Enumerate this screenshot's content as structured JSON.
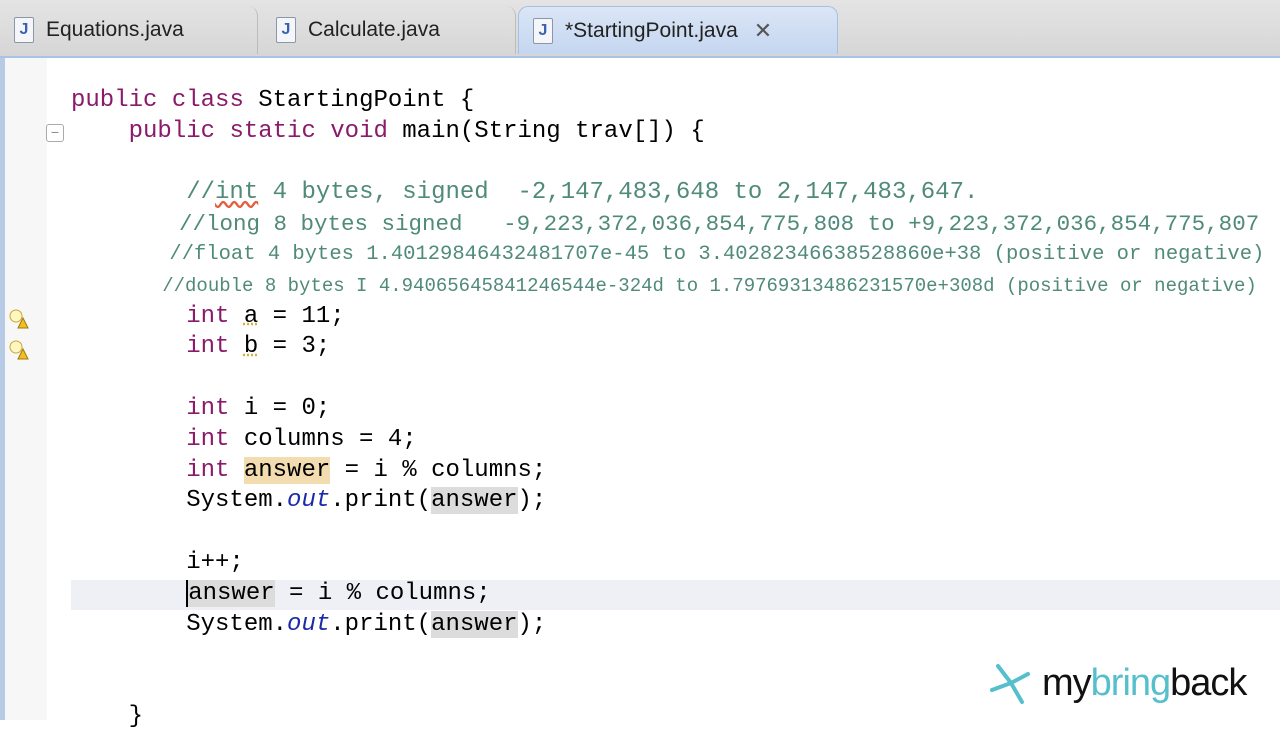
{
  "tabs": [
    {
      "label": "Equations.java",
      "icon": "java-file-icon",
      "active": false
    },
    {
      "label": "Calculate.java",
      "icon": "java-file-icon",
      "active": false
    },
    {
      "label": "*StartingPoint.java",
      "icon": "java-file-warning-icon",
      "active": true,
      "close": "✕"
    }
  ],
  "editor": {
    "lines": [
      [
        {
          "t": "public",
          "c": "kw"
        },
        {
          "t": " "
        },
        {
          "t": "class",
          "c": "kw"
        },
        {
          "t": " StartingPoint {"
        }
      ],
      [
        {
          "t": "    "
        },
        {
          "t": "public",
          "c": "kw"
        },
        {
          "t": " "
        },
        {
          "t": "static",
          "c": "kw"
        },
        {
          "t": " "
        },
        {
          "t": "void",
          "c": "kw"
        },
        {
          "t": " main(String trav[]) {"
        }
      ],
      [],
      [
        {
          "t": "        //",
          "c": "cm"
        },
        {
          "t": "int",
          "c": "cm sq"
        },
        {
          "t": " 4 bytes, signed  -2,147,483,648 to 2,147,483,647.",
          "c": "cm"
        }
      ],
      [
        {
          "t": "        //long 8 bytes signed   -9,223,372,036,854,775,808 to +9,223,372,036,854,775,807",
          "c": "cm"
        }
      ],
      [
        {
          "t": "        //float 4 bytes 1.40129846432481707e-45 to 3.40282346638528860e+38 (positive or negative)",
          "c": "cm"
        }
      ],
      [
        {
          "t": "        //double 8 bytes I 4.94065645841246544e-324d to 1.79769313486231570e+308d (positive or negative)",
          "c": "cm"
        }
      ],
      [
        {
          "t": "        "
        },
        {
          "t": "int",
          "c": "kw"
        },
        {
          "t": " "
        },
        {
          "t": "a",
          "c": "sqy"
        },
        {
          "t": " = 11;"
        }
      ],
      [
        {
          "t": "        "
        },
        {
          "t": "int",
          "c": "kw"
        },
        {
          "t": " "
        },
        {
          "t": "b",
          "c": "sqy"
        },
        {
          "t": " = 3;"
        }
      ],
      [],
      [
        {
          "t": "        "
        },
        {
          "t": "int",
          "c": "kw"
        },
        {
          "t": " i = 0;"
        }
      ],
      [
        {
          "t": "        "
        },
        {
          "t": "int",
          "c": "kw"
        },
        {
          "t": " columns = 4;"
        }
      ],
      [
        {
          "t": "        "
        },
        {
          "t": "int",
          "c": "kw"
        },
        {
          "t": " "
        },
        {
          "t": "answer",
          "c": "hl1"
        },
        {
          "t": " = i % columns;"
        }
      ],
      [
        {
          "t": "        System."
        },
        {
          "t": "out",
          "c": "fld"
        },
        {
          "t": ".print("
        },
        {
          "t": "answer",
          "c": "hl2"
        },
        {
          "t": ");"
        }
      ],
      [],
      [
        {
          "t": "        i++;"
        }
      ],
      [
        {
          "t": "        "
        },
        {
          "t": "answer",
          "c": "hl2 caret"
        },
        {
          "t": " = i % columns;"
        }
      ],
      [
        {
          "t": "        System."
        },
        {
          "t": "out",
          "c": "fld"
        },
        {
          "t": ".print("
        },
        {
          "t": "answer",
          "c": "hl2"
        },
        {
          "t": ");"
        }
      ],
      [],
      [],
      [
        {
          "t": "    }"
        }
      ]
    ]
  },
  "watermark": {
    "part1": "my",
    "part2": "bring",
    "part3": "back",
    "accent": "#55bfcc"
  }
}
